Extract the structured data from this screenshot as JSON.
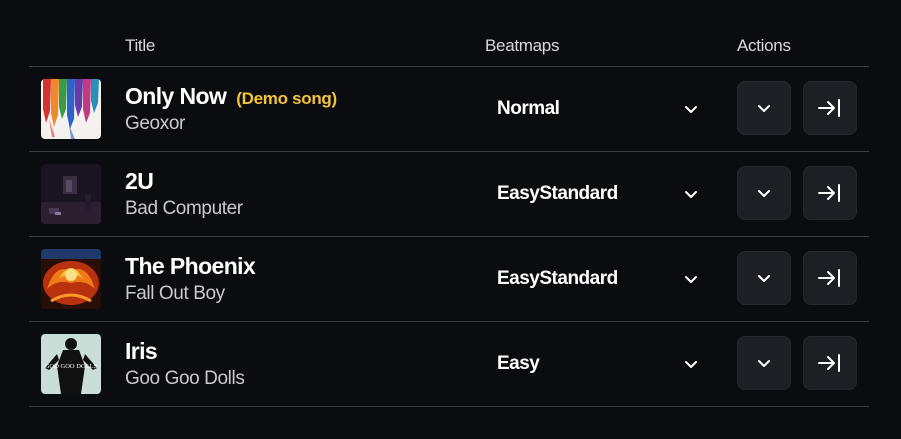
{
  "header": {
    "title": "Title",
    "beatmaps": "Beatmaps",
    "actions": "Actions"
  },
  "songs": [
    {
      "title": "Only Now",
      "tag": "(Demo song)",
      "artist": "Geoxor",
      "beatmap": "Normal",
      "cover_icon": "abstract-paint-cover"
    },
    {
      "title": "2U",
      "tag": "",
      "artist": "Bad Computer",
      "beatmap": "EasyStandard",
      "cover_icon": "dark-room-cover"
    },
    {
      "title": "The Phoenix",
      "tag": "",
      "artist": "Fall Out Boy",
      "beatmap": "EasyStandard",
      "cover_icon": "fire-phoenix-cover"
    },
    {
      "title": "Iris",
      "tag": "",
      "artist": "Goo Goo Dolls",
      "beatmap": "Easy",
      "cover_icon": "silhouette-cover",
      "cover_text": "GOO GOO DOLLS"
    }
  ],
  "colors": {
    "background": "#0b0c10",
    "demo_tag": "#f3c43a",
    "button_bg": "#1d1f25",
    "divider": "#3a3c44"
  }
}
